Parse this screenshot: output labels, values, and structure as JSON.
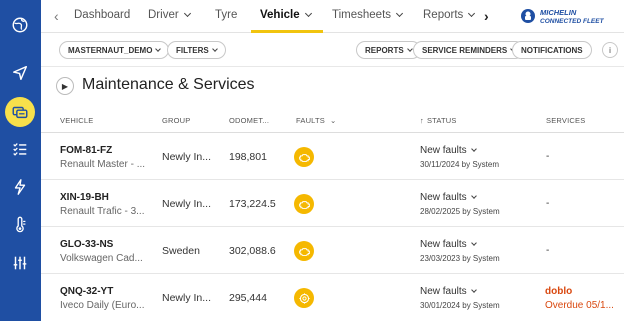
{
  "sidebar": {
    "items": [
      {
        "icon": "globe-icon"
      },
      {
        "icon": "navigation-arrow-icon"
      },
      {
        "icon": "vehicles-icon",
        "active": true
      },
      {
        "icon": "checklist-icon"
      },
      {
        "icon": "lightning-icon"
      },
      {
        "icon": "thermometer-icon"
      },
      {
        "icon": "sliders-icon"
      }
    ],
    "active_color": "#f7e04b",
    "bg_color": "#1f4fa3"
  },
  "nav": {
    "tabs": [
      {
        "label": "Dashboard"
      },
      {
        "label": "Driver"
      },
      {
        "label": "Tyre"
      },
      {
        "label": "Vehicle"
      },
      {
        "label": "Timesheets"
      },
      {
        "label": "Reports"
      }
    ],
    "active_tab": "Vehicle",
    "brand": {
      "line1": "MICHELIN",
      "line2": "CONNECTED FLEET"
    }
  },
  "filterbar": {
    "account": "MASTERNAUT_DEMO",
    "filters": "FILTERS",
    "reports": "REPORTS",
    "service_reminders": "SERVICE REMINDERS",
    "notifications": "NOTIFICATIONS",
    "info": "i"
  },
  "page": {
    "title": "Maintenance & Services"
  },
  "table": {
    "headers": {
      "vehicle": "VEHICLE",
      "group": "GROUP",
      "odometer": "ODOMET...",
      "faults": "FAULTS",
      "status": "STATUS",
      "services": "SERVICES"
    },
    "rows": [
      {
        "plate": "FOM-81-FZ",
        "model": "Renault Master - ...",
        "group": "Newly In...",
        "odometer": "198,801",
        "status": "New faults",
        "date": "30/11/2024 by System",
        "services": "-"
      },
      {
        "plate": "XIN-19-BH",
        "model": "Renault Trafic - 3...",
        "group": "Newly In...",
        "odometer": "173,224.5",
        "status": "New faults",
        "date": "28/02/2025 by System",
        "services": "-"
      },
      {
        "plate": "GLO-33-NS",
        "model": "Volkswagen Cad...",
        "group": "Sweden",
        "odometer": "302,088.6",
        "status": "New faults",
        "date": "23/03/2023 by System",
        "services": "-"
      },
      {
        "plate": "QNQ-32-YT",
        "model": "Iveco Daily (Euro...",
        "group": "Newly In...",
        "odometer": "295,444",
        "status": "New faults",
        "date": "30/01/2024 by System",
        "services": "doblo",
        "services_sub": "Overdue 05/1..."
      }
    ]
  },
  "colors": {
    "fault_icon": "#f5b800",
    "overdue": "#d9480f",
    "tab_underline": "#f1c40f"
  }
}
